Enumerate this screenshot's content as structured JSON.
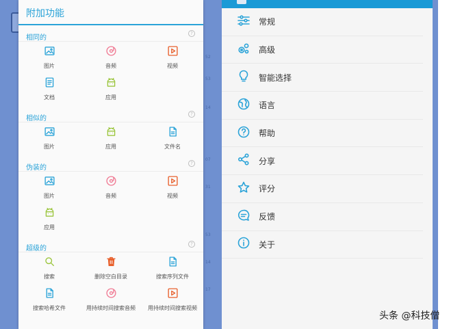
{
  "left_panel": {
    "title": "附加功能",
    "sections": [
      {
        "title": "相同的",
        "items": [
          {
            "label": "图片",
            "icon": "image-icon",
            "color": "#2aa3d8"
          },
          {
            "label": "音频",
            "icon": "audio-disc-icon",
            "color": "#f07b94"
          },
          {
            "label": "视频",
            "icon": "video-play-icon",
            "color": "#e8602c"
          },
          {
            "label": "文档",
            "icon": "document-icon",
            "color": "#2aa3d8"
          },
          {
            "label": "应用",
            "icon": "android-icon",
            "color": "#9bc53d"
          }
        ]
      },
      {
        "title": "相似的",
        "items": [
          {
            "label": "图片",
            "icon": "image-icon",
            "color": "#2aa3d8"
          },
          {
            "label": "应用",
            "icon": "android-icon",
            "color": "#9bc53d"
          },
          {
            "label": "文件名",
            "icon": "file-icon",
            "color": "#2aa3d8"
          }
        ]
      },
      {
        "title": "伪装的",
        "items": [
          {
            "label": "图片",
            "icon": "image-icon",
            "color": "#2aa3d8"
          },
          {
            "label": "音频",
            "icon": "audio-disc-icon",
            "color": "#f07b94"
          },
          {
            "label": "视频",
            "icon": "video-play-icon",
            "color": "#e8602c"
          },
          {
            "label": "应用",
            "icon": "android-icon",
            "color": "#9bc53d"
          }
        ]
      },
      {
        "title": "超级的",
        "items": [
          {
            "label": "搜索",
            "icon": "search-icon",
            "color": "#9bc53d"
          },
          {
            "label": "删除空白目录",
            "icon": "trash-icon",
            "color": "#e8602c"
          },
          {
            "label": "搜索序列文件",
            "icon": "file-icon",
            "color": "#2aa3d8"
          },
          {
            "label": "搜索哈希文件",
            "icon": "file-icon",
            "color": "#2aa3d8"
          },
          {
            "label": "用持续时间搜索音频",
            "icon": "audio-disc-icon",
            "color": "#f07b94"
          },
          {
            "label": "用持续时间搜索视频",
            "icon": "video-play-icon",
            "color": "#e8602c"
          }
        ]
      }
    ]
  },
  "right_menu": {
    "items": [
      {
        "label": "常规",
        "icon": "sliders-icon"
      },
      {
        "label": "高级",
        "icon": "gears-icon"
      },
      {
        "label": "智能选择",
        "icon": "lightbulb-icon"
      },
      {
        "label": "语言",
        "icon": "globe-icon"
      },
      {
        "label": "帮助",
        "icon": "help-icon"
      },
      {
        "label": "分享",
        "icon": "share-icon"
      },
      {
        "label": "评分",
        "icon": "star-icon"
      },
      {
        "label": "反馈",
        "icon": "feedback-icon"
      },
      {
        "label": "关于",
        "icon": "info-icon"
      }
    ],
    "icon_color": "#2aa3d8"
  },
  "gutter_numbers": [
    "52",
    "53",
    "14",
    "07",
    "31",
    "53",
    "14",
    "17"
  ],
  "watermark": "头条 @科技僧"
}
